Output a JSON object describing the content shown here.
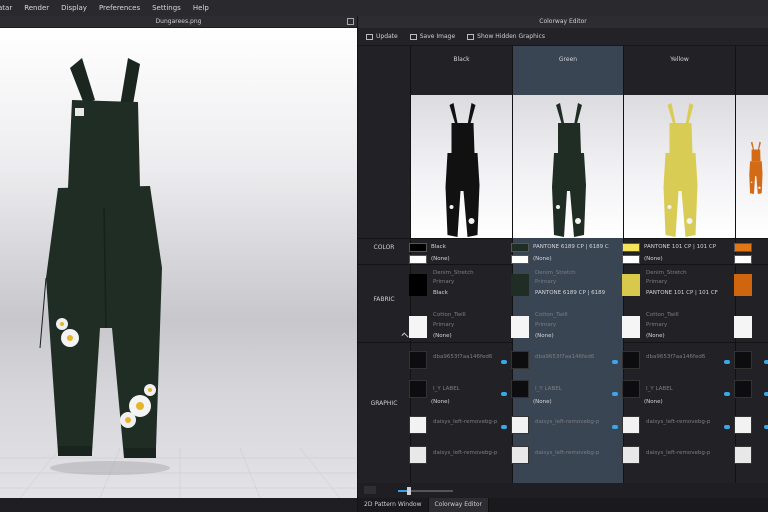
{
  "menu": [
    "atar",
    "Render",
    "Display",
    "Preferences",
    "Settings",
    "Help"
  ],
  "viewport": {
    "title": "Dungarees.png"
  },
  "editor": {
    "title": "Colorway Editor",
    "toolbar": {
      "update": "Update",
      "save_image": "Save Image",
      "show_hidden": "Show Hidden Graphics"
    },
    "row_labels": {
      "color": "COLOR",
      "fabric": "FABRIC",
      "graphic": "GRAPHIC"
    },
    "columns": [
      {
        "name": "Black",
        "garment_color": "#111111",
        "color1_hex": "#000000",
        "color1_label": "Black",
        "color2_label": "(None)",
        "fabric1_name": "Denim_Stretch",
        "fabric1_sub": "Primary",
        "fabric1_value": "Black",
        "fabric1_hex": "#000000",
        "fabric2_name": "Cotton_Twill",
        "fabric2_sub": "Primary",
        "fabric2_value": "(None)",
        "g1_name": "dba9653f7aa146fed6",
        "g2_name": "I_Y LABEL",
        "g2_value": "(None)",
        "g3_name": "daisys_left-removebg-p",
        "g4_name": "daisys_left-removebg-p"
      },
      {
        "name": "Green",
        "garment_color": "#1f2d24",
        "color1_hex": "#1f2d24",
        "color1_label": "PANTONE 6189 CP | 6189 C",
        "color2_label": "(None)",
        "fabric1_name": "Denim_Stretch",
        "fabric1_sub": "Primary",
        "fabric1_value": "PANTONE 6189 CP | 6189",
        "fabric1_hex": "#1f2d24",
        "fabric2_name": "Cotton_Twill",
        "fabric2_sub": "Primary",
        "fabric2_value": "(None)",
        "g1_name": "dba9653f7aa146fed6",
        "g2_name": "I_Y LABEL",
        "g2_value": "(None)",
        "g3_name": "daisys_left-removebg-p",
        "g4_name": "daisys_left-removebg-p"
      },
      {
        "name": "Yellow",
        "garment_color": "#d9cc55",
        "color1_hex": "#f2e35a",
        "color1_label": "PANTONE 101 CP | 101 CP",
        "color2_label": "(None)",
        "fabric1_name": "Denim_Stretch",
        "fabric1_sub": "Primary",
        "fabric1_value": "PANTONE 101 CP | 101 CF",
        "fabric1_hex": "#d8c94c",
        "fabric2_name": "Cotton_Twill",
        "fabric2_sub": "Primary",
        "fabric2_value": "(None)",
        "g1_name": "dba9653f7aa146fed6",
        "g2_name": "I_Y LABEL",
        "g2_value": "(None)",
        "g3_name": "daisys_left-removebg-p",
        "g4_name": "daisys_left-removebg-p"
      },
      {
        "name": "",
        "garment_color": "#d36a16",
        "color1_hex": "#e27614",
        "color1_label": "",
        "color2_label": "",
        "fabric1_name": "",
        "fabric1_sub": "",
        "fabric1_value": "",
        "fabric1_hex": "#d0650f",
        "fabric2_name": "",
        "fabric2_sub": "",
        "fabric2_value": "",
        "g1_name": "",
        "g2_name": "",
        "g2_value": "",
        "g3_name": "",
        "g4_name": ""
      }
    ],
    "zoom_fraction": 0.2
  },
  "tabs": [
    "2D Pattern Window",
    "Colorway Editor"
  ],
  "colors": {
    "accent": "#3aa0e6",
    "selected_column": "#3a4553",
    "garment_main": "#1f2d24"
  }
}
